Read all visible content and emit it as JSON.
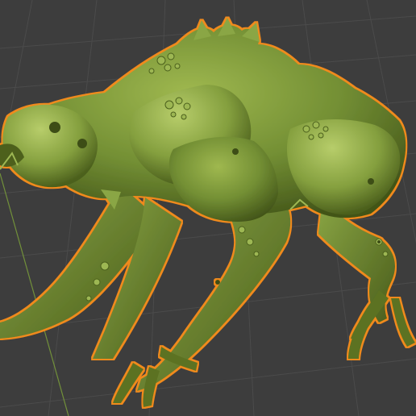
{
  "viewport": {
    "editor": "3d-viewport",
    "background_color": "#3d3d3d",
    "grid_color": "#4a4a4a",
    "y_axis_color": "#7fa53a",
    "x_axis_color": "#c43a4a"
  },
  "model": {
    "name": "green-creature-sculpt",
    "selected": true,
    "base_color": "#6f8a32",
    "highlight_color": "#a9c45a",
    "shadow_color": "#3c4d17",
    "selection_outline_color": "#f08a1e"
  }
}
